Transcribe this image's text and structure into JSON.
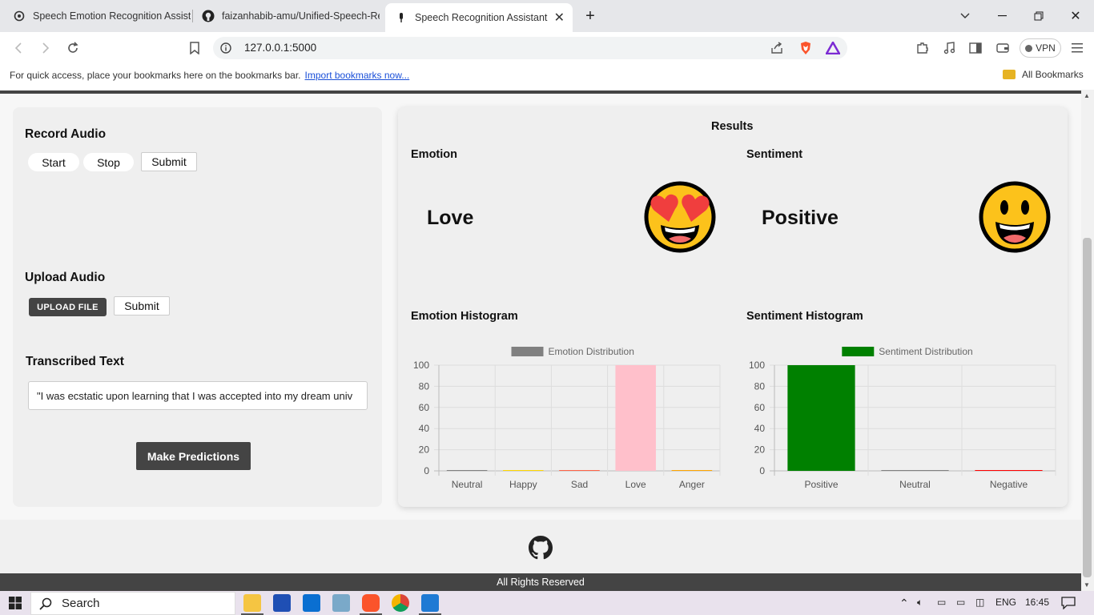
{
  "browser": {
    "tabs": [
      {
        "title": "Speech Emotion Recognition Assista",
        "active": false,
        "icon": "openai-icon"
      },
      {
        "title": "faizanhabib-amu/Unified-Speech-Re",
        "active": false,
        "icon": "github-icon"
      },
      {
        "title": "Speech Recognition Assistant",
        "active": true,
        "icon": "mic-icon"
      }
    ],
    "url": "127.0.0.1:5000",
    "vpn_label": "VPN",
    "bookmarks_text": "For quick access, place your bookmarks here on the bookmarks bar.",
    "bookmarks_link": "Import bookmarks now...",
    "all_bookmarks": "All Bookmarks"
  },
  "left": {
    "record_title": "Record Audio",
    "start": "Start",
    "stop": "Stop",
    "submit": "Submit",
    "upload_title": "Upload Audio",
    "upload_file": "UPLOAD FILE",
    "upload_submit": "Submit",
    "transcribed_title": "Transcribed Text",
    "transcribed_text": "\"I was ecstatic upon learning that I was accepted into my dream univ",
    "predict": "Make Predictions"
  },
  "results": {
    "title": "Results",
    "emotion_title": "Emotion",
    "emotion_value": "Love",
    "emotion_icon": "heart-eyes-emoji-icon",
    "sentiment_title": "Sentiment",
    "sentiment_value": "Positive",
    "sentiment_icon": "smiley-emoji-icon",
    "emotion_hist_title": "Emotion Histogram",
    "sentiment_hist_title": "Sentiment Histogram"
  },
  "chart_data": [
    {
      "type": "bar",
      "categories": [
        "Neutral",
        "Happy",
        "Sad",
        "Love",
        "Anger"
      ],
      "series": [
        {
          "name": "Emotion Distribution",
          "values": [
            0,
            0,
            0,
            100,
            0
          ]
        }
      ],
      "colors": [
        "#808080",
        "#ffd700",
        "#ff6347",
        "#ffc0cb",
        "#ffa500"
      ],
      "legend_color": "#808080",
      "ylim": [
        0,
        100
      ],
      "yticks": [
        0,
        20,
        40,
        60,
        80,
        100
      ],
      "grid": true,
      "legend": "top"
    },
    {
      "type": "bar",
      "categories": [
        "Positive",
        "Neutral",
        "Negative"
      ],
      "series": [
        {
          "name": "Sentiment Distribution",
          "values": [
            100,
            0,
            0
          ]
        }
      ],
      "colors": [
        "#008000",
        "#808080",
        "#ff0000"
      ],
      "legend_color": "#008000",
      "ylim": [
        0,
        100
      ],
      "yticks": [
        0,
        20,
        40,
        60,
        80,
        100
      ],
      "grid": true,
      "legend": "top"
    }
  ],
  "footer": {
    "text": "All Rights Reserved",
    "icon": "github-icon"
  },
  "taskbar": {
    "search": "Search",
    "lang": "ENG",
    "time": "16:45"
  }
}
